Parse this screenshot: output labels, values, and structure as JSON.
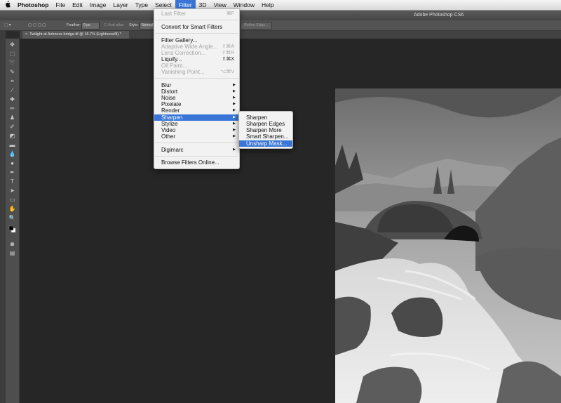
{
  "menubar": {
    "apple": "",
    "items": [
      "Photoshop",
      "File",
      "Edit",
      "Image",
      "Layer",
      "Type",
      "Select",
      "Filter",
      "3D",
      "View",
      "Window",
      "Help"
    ]
  },
  "window_title": "Adobe Photoshop CS6",
  "options_bar": {
    "feather_label": "Feather:",
    "feather_value": "0 px",
    "anti_alias": "Anti-alias",
    "style_label": "Style:",
    "style_value": "Normal",
    "refine_edge": "Refine Edge..."
  },
  "document_tab": "Twilight at Ashness bridge.tif @ 16.7% (Lightness/8) *",
  "filter_menu": {
    "last_filter": "Last Filter",
    "last_filter_sc": "⌘F",
    "convert": "Convert for Smart Filters",
    "gallery": "Filter Gallery...",
    "adaptive": "Adaptive Wide Angle...",
    "adaptive_sc": "⇧⌘A",
    "lens": "Lens Correction...",
    "lens_sc": "⇧⌘R",
    "liquify": "Liquify...",
    "liquify_sc": "⇧⌘X",
    "oil": "Oil Paint...",
    "vanishing": "Vanishing Point...",
    "vanishing_sc": "⌥⌘V",
    "blur": "Blur",
    "distort": "Distort",
    "noise": "Noise",
    "pixelate": "Pixelate",
    "render": "Render",
    "sharpen": "Sharpen",
    "stylize": "Stylize",
    "video": "Video",
    "other": "Other",
    "digimarc": "Digimarc",
    "browse": "Browse Filters Online..."
  },
  "sharpen_submenu": [
    "Sharpen",
    "Sharpen Edges",
    "Sharpen More",
    "Smart Sharpen...",
    "Unsharp Mask..."
  ],
  "colors": {
    "highlight": "#3875d7"
  }
}
